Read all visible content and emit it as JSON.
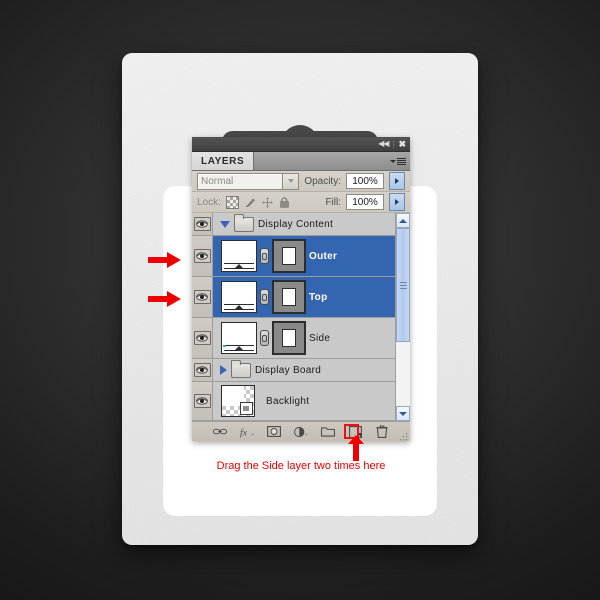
{
  "panel": {
    "titlebar": {
      "collapse_icon": "collapse-icon",
      "close_icon": "close-icon"
    },
    "tab_label": "LAYERS",
    "menu_icon": "panel-menu-icon",
    "blend_mode": {
      "value": "Normal",
      "dropdown_icon": "chevron-down-icon"
    },
    "opacity": {
      "label": "Opacity:",
      "value": "100%",
      "stepper_icon": "stepper-arrow-icon"
    },
    "fill": {
      "label": "Fill:",
      "value": "100%",
      "stepper_icon": "stepper-arrow-icon"
    },
    "lock": {
      "label": "Lock:",
      "icons": [
        "lock-transparency-icon",
        "lock-image-icon",
        "lock-position-icon",
        "lock-all-icon"
      ]
    },
    "layers": [
      {
        "name": "Display Content",
        "type": "group",
        "expanded": true,
        "selected": false,
        "visible": true
      },
      {
        "name": "Outer",
        "type": "layer",
        "selected": true,
        "visible": true,
        "has_mask": true,
        "linked": true
      },
      {
        "name": "Top",
        "type": "layer",
        "selected": true,
        "visible": true,
        "has_mask": true,
        "linked": true
      },
      {
        "name": "Side",
        "type": "layer",
        "selected": false,
        "visible": true,
        "has_mask": true,
        "linked": true
      },
      {
        "name": "Display Board",
        "type": "group",
        "expanded": false,
        "selected": false,
        "visible": true
      },
      {
        "name": "Backlight",
        "type": "layer",
        "selected": false,
        "visible": true,
        "has_mask": false,
        "linked": false
      }
    ],
    "footer_icons": [
      "link-layers-icon",
      "layer-style-fx-icon",
      "add-layer-mask-icon",
      "new-adjustment-layer-icon",
      "new-group-icon",
      "new-layer-icon",
      "delete-layer-icon"
    ],
    "highlighted_footer_icon": "new-layer-icon",
    "scrollbar": {
      "up_icon": "scroll-up-icon",
      "down_icon": "scroll-down-icon",
      "thumb_icon": "scroll-thumb-grip"
    }
  },
  "annotation": {
    "note_text": "Drag the Side layer two times here",
    "note_color": "#ee0000",
    "arrows": [
      "arrow-to-outer-layer",
      "arrow-to-top-layer",
      "arrow-to-new-layer-button"
    ]
  },
  "package": {
    "hang_hole_icon": "hang-hole-slot",
    "card_color": "#f0f0f0",
    "inner_panel_color": "#ffffff"
  }
}
